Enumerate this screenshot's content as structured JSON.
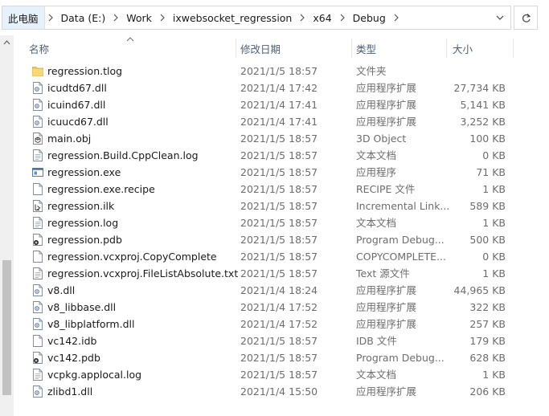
{
  "breadcrumb": {
    "items": [
      "此电脑",
      "Data (E:)",
      "Work",
      "ixwebsocket_regression",
      "x64",
      "Debug"
    ]
  },
  "columns": {
    "name": "名称",
    "date": "修改日期",
    "type": "类型",
    "size": "大小"
  },
  "files": [
    {
      "name": "regression.tlog",
      "date": "2021/1/5 18:57",
      "type": "文件夹",
      "size": "",
      "icon": "folder-icon"
    },
    {
      "name": "icudtd67.dll",
      "date": "2021/1/4 17:42",
      "type": "应用程序扩展",
      "size": "27,734 KB",
      "icon": "dll-icon"
    },
    {
      "name": "icuind67.dll",
      "date": "2021/1/4 17:41",
      "type": "应用程序扩展",
      "size": "5,141 KB",
      "icon": "dll-icon"
    },
    {
      "name": "icuucd67.dll",
      "date": "2021/1/4 17:41",
      "type": "应用程序扩展",
      "size": "3,252 KB",
      "icon": "dll-icon"
    },
    {
      "name": "main.obj",
      "date": "2021/1/5 18:57",
      "type": "3D Object",
      "size": "100 KB",
      "icon": "3d-object-icon"
    },
    {
      "name": "regression.Build.CppClean.log",
      "date": "2021/1/5 18:57",
      "type": "文本文档",
      "size": "0 KB",
      "icon": "text-file-icon"
    },
    {
      "name": "regression.exe",
      "date": "2021/1/5 18:57",
      "type": "应用程序",
      "size": "71 KB",
      "icon": "exe-icon"
    },
    {
      "name": "regression.exe.recipe",
      "date": "2021/1/5 18:57",
      "type": "RECIPE 文件",
      "size": "1 KB",
      "icon": "blank-file-icon"
    },
    {
      "name": "regression.ilk",
      "date": "2021/1/5 18:57",
      "type": "Incremental Link...",
      "size": "589 KB",
      "icon": "ilk-icon"
    },
    {
      "name": "regression.log",
      "date": "2021/1/5 18:57",
      "type": "文本文档",
      "size": "1 KB",
      "icon": "text-file-icon"
    },
    {
      "name": "regression.pdb",
      "date": "2021/1/5 18:57",
      "type": "Program Debug...",
      "size": "500 KB",
      "icon": "pdb-icon"
    },
    {
      "name": "regression.vcxproj.CopyComplete",
      "date": "2021/1/5 18:57",
      "type": "COPYCOMPLETE...",
      "size": "0 KB",
      "icon": "blank-file-icon"
    },
    {
      "name": "regression.vcxproj.FileListAbsolute.txt",
      "date": "2021/1/5 18:57",
      "type": "Text 源文件",
      "size": "1 KB",
      "icon": "text-file-icon"
    },
    {
      "name": "v8.dll",
      "date": "2021/1/4 18:24",
      "type": "应用程序扩展",
      "size": "44,965 KB",
      "icon": "dll-icon"
    },
    {
      "name": "v8_libbase.dll",
      "date": "2021/1/4 17:52",
      "type": "应用程序扩展",
      "size": "322 KB",
      "icon": "dll-icon"
    },
    {
      "name": "v8_libplatform.dll",
      "date": "2021/1/4 17:52",
      "type": "应用程序扩展",
      "size": "257 KB",
      "icon": "dll-icon"
    },
    {
      "name": "vc142.idb",
      "date": "2021/1/5 18:57",
      "type": "IDB 文件",
      "size": "179 KB",
      "icon": "blank-file-icon"
    },
    {
      "name": "vc142.pdb",
      "date": "2021/1/5 18:57",
      "type": "Program Debug...",
      "size": "628 KB",
      "icon": "pdb-icon"
    },
    {
      "name": "vcpkg.applocal.log",
      "date": "2021/1/5 18:57",
      "type": "文本文档",
      "size": "1 KB",
      "icon": "text-file-icon"
    },
    {
      "name": "zlibd1.dll",
      "date": "2021/1/4 15:50",
      "type": "应用程序扩展",
      "size": "206 KB",
      "icon": "dll-icon"
    }
  ]
}
